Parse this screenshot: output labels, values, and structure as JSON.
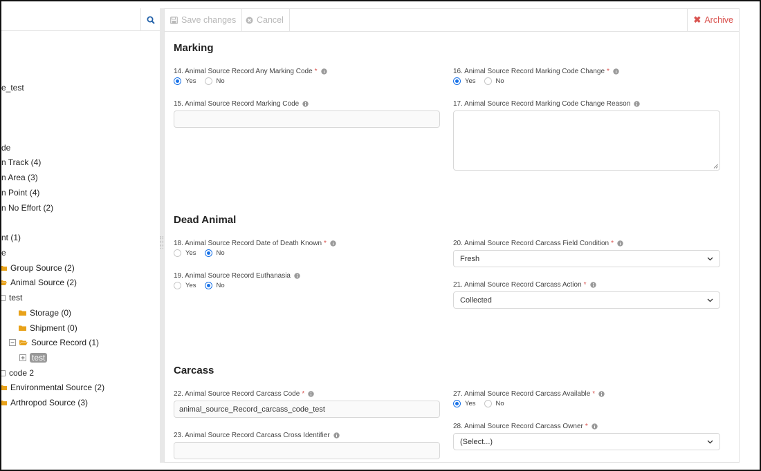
{
  "colors": {
    "accent": "#1a73e8",
    "danger": "#d9534f",
    "folder": "#e8a21a",
    "muted": "#b9b9b9"
  },
  "tree": {
    "items": [
      {
        "label": "e_test"
      },
      {
        "label": "de"
      },
      {
        "label": "n Track (4)"
      },
      {
        "label": "n Area (3)"
      },
      {
        "label": "n Point (4)"
      },
      {
        "label": "n No Effort (2)"
      },
      {
        "label": "nt (1)"
      },
      {
        "label": "e"
      },
      {
        "label": "Group Source (2)"
      },
      {
        "label": "Animal Source (2)"
      },
      {
        "label": "test"
      },
      {
        "label": "Storage (0)"
      },
      {
        "label": "Shipment (0)"
      },
      {
        "label": "Source Record (1)"
      },
      {
        "label": "test"
      },
      {
        "label": "code 2"
      },
      {
        "label": "Environmental Source (2)"
      },
      {
        "label": "Arthropod Source (3)"
      }
    ]
  },
  "toolbar": {
    "save_label": "Save changes",
    "cancel_label": "Cancel",
    "archive_label": "Archive"
  },
  "sections": {
    "marking": "Marking",
    "dead_animal": "Dead Animal",
    "carcass": "Carcass"
  },
  "radio": {
    "yes": "Yes",
    "no": "No"
  },
  "fields": {
    "f14": {
      "label": "14. Animal Source Record Any Marking Code",
      "value": "Yes"
    },
    "f15": {
      "label": "15. Animal Source Record Marking Code",
      "value": ""
    },
    "f16": {
      "label": "16. Animal Source Record Marking Code Change",
      "value": "Yes"
    },
    "f17": {
      "label": "17. Animal Source Record Marking Code Change Reason",
      "value": ""
    },
    "f18": {
      "label": "18. Animal Source Record Date of Death Known",
      "value": "No"
    },
    "f19": {
      "label": "19. Animal Source Record Euthanasia",
      "value": "No"
    },
    "f20": {
      "label": "20. Animal Source Record Carcass Field Condition",
      "value": "Fresh"
    },
    "f21": {
      "label": "21. Animal Source Record Carcass Action",
      "value": "Collected"
    },
    "f22": {
      "label": "22. Animal Source Record Carcass Code",
      "value": "animal_source_Record_carcass_code_test"
    },
    "f23": {
      "label": "23. Animal Source Record Carcass Cross Identifier",
      "value": ""
    },
    "f27": {
      "label": "27. Animal Source Record Carcass Available",
      "value": "Yes"
    },
    "f28": {
      "label": "28. Animal Source Record Carcass Owner",
      "value": "(Select...)"
    }
  },
  "icons": {
    "search": "search-icon",
    "save": "floppy-disk-icon",
    "cancel": "cancel-circle-icon",
    "archive": "x-icon",
    "info": "info-circle-icon",
    "folder": "folder-icon",
    "folder_open": "folder-open-icon",
    "minus_box": "minus-box-icon",
    "plus_box": "plus-box-icon",
    "chevron": "chevron-down-icon"
  }
}
